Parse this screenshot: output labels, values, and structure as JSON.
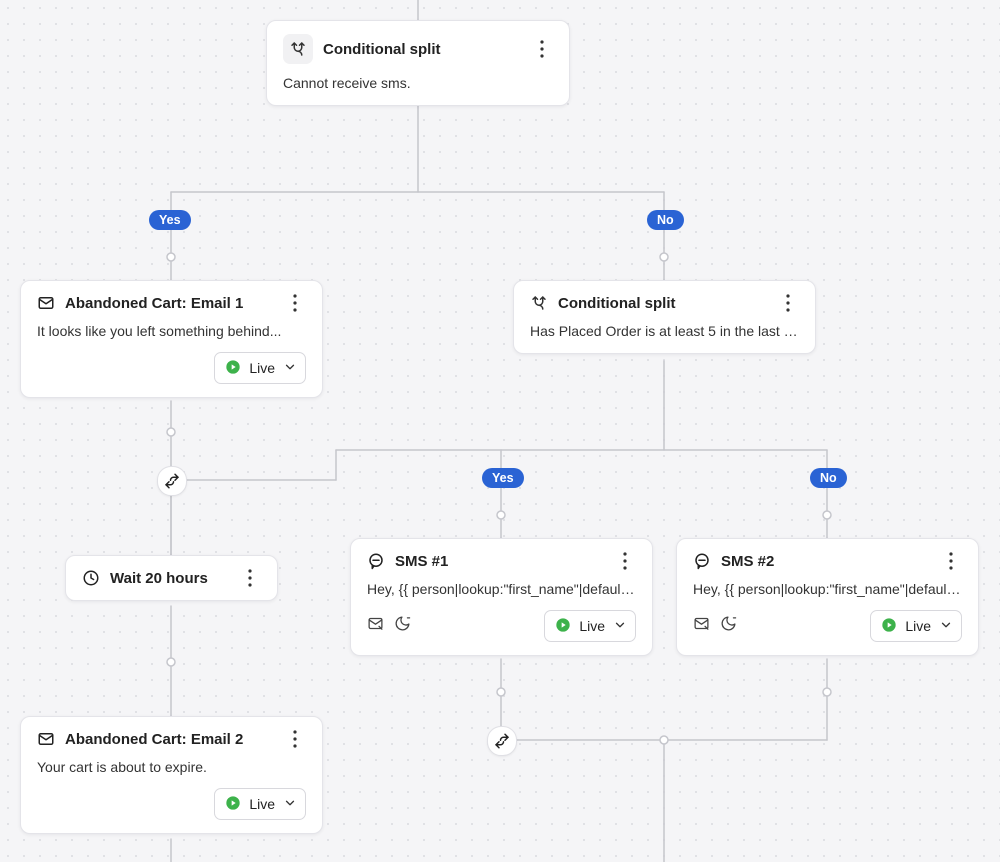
{
  "labels": {
    "yes": "Yes",
    "no": "No"
  },
  "status": {
    "live": "Live"
  },
  "nodes": {
    "cond_root": {
      "title": "Conditional split",
      "desc": "Cannot receive sms."
    },
    "email1": {
      "title": "Abandoned Cart: Email 1",
      "desc": "It looks like you left something behind...",
      "status": "Live"
    },
    "cond_inner": {
      "title": "Conditional split",
      "desc": "Has Placed Order is at least 5 in the last …"
    },
    "wait": {
      "title": "Wait 20 hours"
    },
    "sms1": {
      "title": "SMS #1",
      "desc": "Hey, {{ person|lookup:\"first_name\"|defaul…",
      "status": "Live"
    },
    "sms2": {
      "title": "SMS #2",
      "desc": "Hey, {{ person|lookup:\"first_name\"|defaul…",
      "status": "Live"
    },
    "email2": {
      "title": "Abandoned Cart: Email 2",
      "desc": "Your cart is about to expire.",
      "status": "Live"
    }
  }
}
